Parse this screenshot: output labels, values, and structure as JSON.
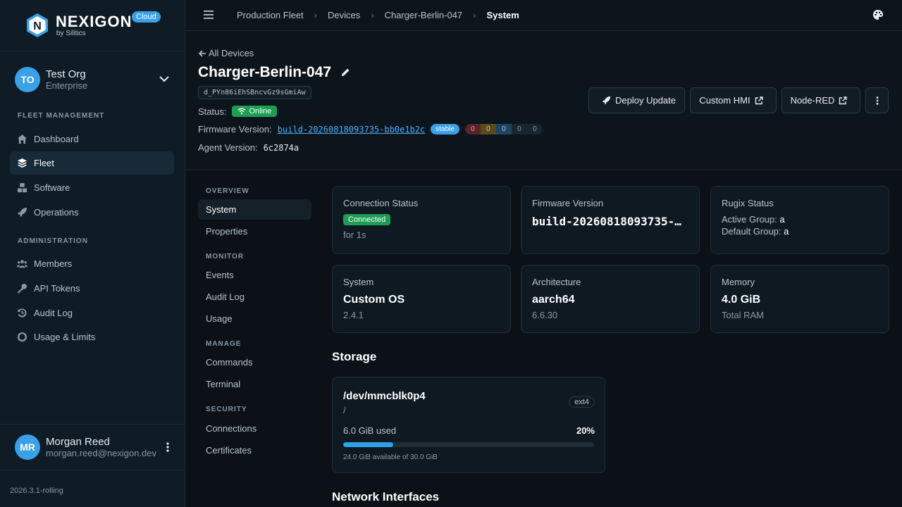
{
  "brand": {
    "name": "NEXIGON",
    "sub": "by Silitics",
    "badge": "Cloud"
  },
  "org": {
    "initials": "TO",
    "name": "Test Org",
    "tier": "Enterprise"
  },
  "nav": {
    "fleet_section": "FLEET MANAGEMENT",
    "admin_section": "ADMINISTRATION",
    "dashboard": "Dashboard",
    "fleet": "Fleet",
    "software": "Software",
    "operations": "Operations",
    "members": "Members",
    "api_tokens": "API Tokens",
    "audit_log": "Audit Log",
    "usage_limits": "Usage & Limits"
  },
  "user": {
    "initials": "MR",
    "name": "Morgan Reed",
    "email": "morgan.reed@nexigon.dev"
  },
  "app_version": "2026.3.1-rolling",
  "breadcrumbs": [
    "Production Fleet",
    "Devices",
    "Charger-Berlin-047",
    "System"
  ],
  "device": {
    "back_label": "All Devices",
    "title": "Charger-Berlin-047",
    "id": "d_PYn86iEhSBncvGz9sGmiAw",
    "status_label": "Status:",
    "status_value": "Online",
    "firmware_label": "Firmware Version:",
    "firmware_value": "build-20260818093735-bb0e1b2c",
    "channel": "stable",
    "counts": [
      "0",
      "0",
      "0",
      "0",
      "0"
    ],
    "agent_label": "Agent Version:",
    "agent_value": "6c2874a"
  },
  "actions": {
    "deploy": "Deploy Update",
    "hmi": "Custom HMI",
    "nodered": "Node-RED"
  },
  "subnav": {
    "overview": "OVERVIEW",
    "system": "System",
    "properties": "Properties",
    "monitor": "MONITOR",
    "events": "Events",
    "audit_log": "Audit Log",
    "usage": "Usage",
    "manage": "MANAGE",
    "commands": "Commands",
    "terminal": "Terminal",
    "security": "SECURITY",
    "connections": "Connections",
    "certificates": "Certificates"
  },
  "cards": {
    "connection": {
      "label": "Connection Status",
      "badge": "Connected",
      "sub": "for 1s"
    },
    "firmware": {
      "label": "Firmware Version",
      "value": "build-20260818093735-…"
    },
    "rugix": {
      "label": "Rugix Status",
      "active_label": "Active Group:",
      "active_value": "a",
      "default_label": "Default Group:",
      "default_value": "a"
    },
    "system": {
      "label": "System",
      "value": "Custom OS",
      "sub": "2.4.1"
    },
    "arch": {
      "label": "Architecture",
      "value": "aarch64",
      "sub": "6.6.30"
    },
    "memory": {
      "label": "Memory",
      "value": "4.0 GiB",
      "sub": "Total RAM"
    }
  },
  "storage": {
    "title": "Storage",
    "device": "/dev/mmcblk0p4",
    "mount": "/",
    "fs": "ext4",
    "used": "6.0 GiB used",
    "percent": "20%",
    "fill": 0.2,
    "available": "24.0 GiB available of 30.0 GiB"
  },
  "network_title": "Network Interfaces",
  "colors": {
    "accent": "#3aa0e8",
    "success": "#1f9d55",
    "background": "#0b1117"
  }
}
